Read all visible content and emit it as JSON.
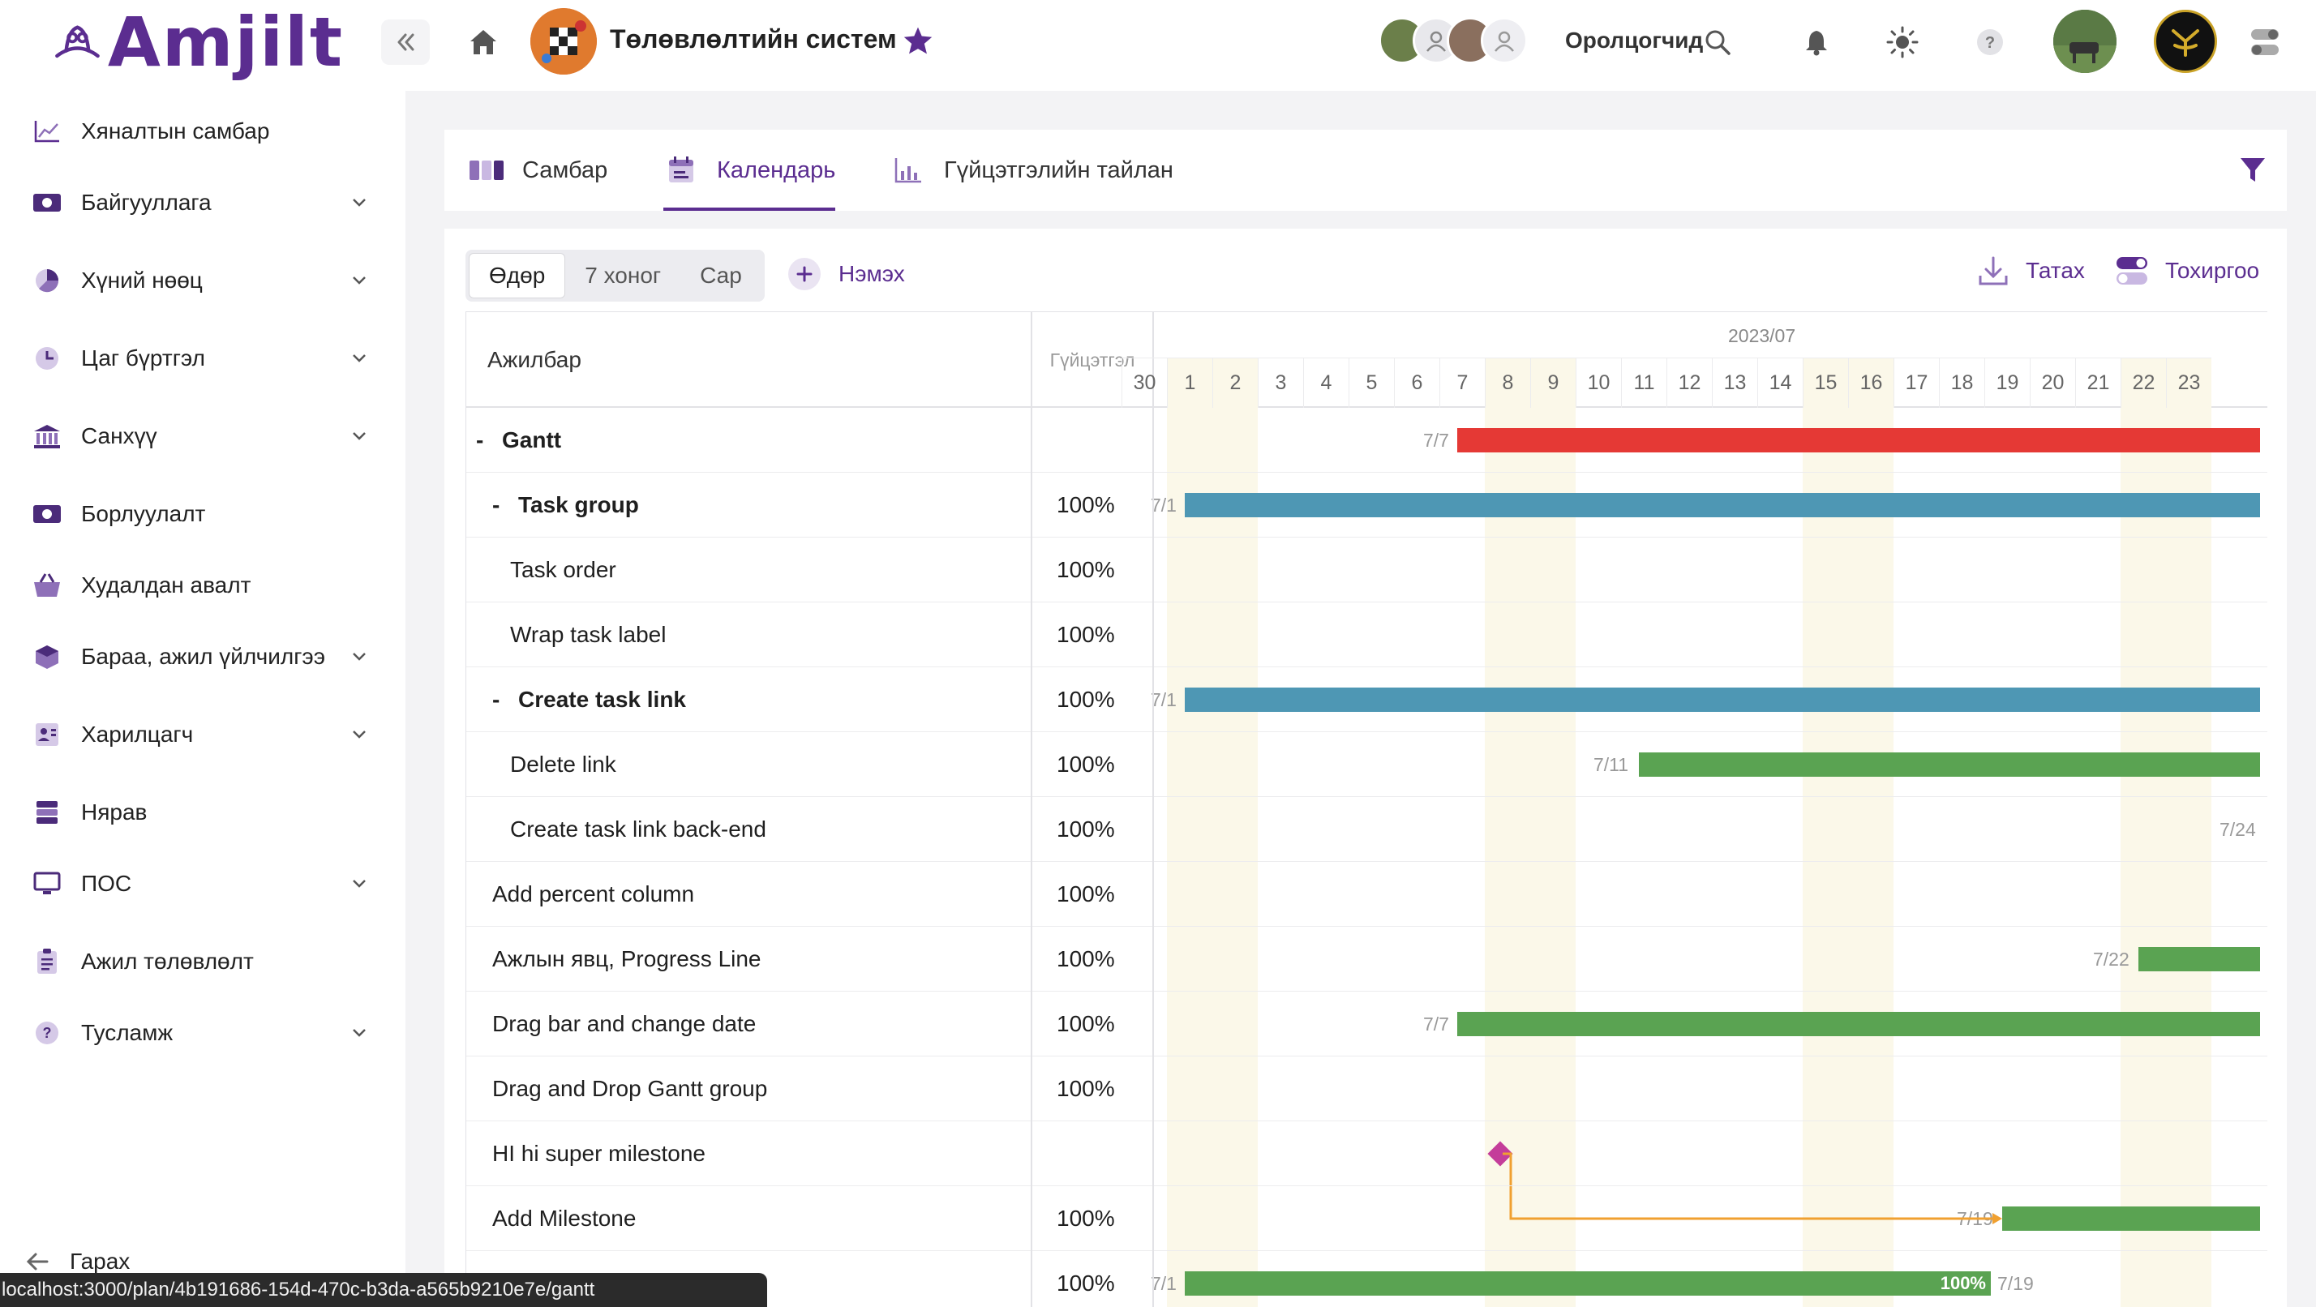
{
  "brand": {
    "name": "Amjilt",
    "color": "#5b2d90"
  },
  "header": {
    "project_title": "Төлөвлөлтийн систем",
    "participants_label": "Оролцогчид",
    "collapse_icon": "double-chevron-left-icon",
    "home_icon": "home-icon",
    "star_icon": "star-icon",
    "search_icon": "search-icon",
    "bell_icon": "bell-icon",
    "theme_icon": "sun-icon",
    "help_icon": "help-icon"
  },
  "sidebar": {
    "items": [
      {
        "label": "Хяналтын самбар",
        "icon": "chart-line-icon",
        "has_children": false
      },
      {
        "label": "Байгууллага",
        "icon": "money-icon",
        "has_children": true
      },
      {
        "label": "Хүний нөөц",
        "icon": "pie-icon",
        "has_children": true
      },
      {
        "label": "Цаг бүртгэл",
        "icon": "clock-icon",
        "has_children": true
      },
      {
        "label": "Санхүү",
        "icon": "bank-icon",
        "has_children": true
      },
      {
        "label": "Борлуулалт",
        "icon": "money-icon",
        "has_children": false
      },
      {
        "label": "Худалдан авалт",
        "icon": "basket-icon",
        "has_children": false
      },
      {
        "label": "Бараа, ажил үйлчилгээ",
        "icon": "box-icon",
        "has_children": true
      },
      {
        "label": "Харилцагч",
        "icon": "contact-icon",
        "has_children": true
      },
      {
        "label": "Нярав",
        "icon": "archive-icon",
        "has_children": false
      },
      {
        "label": "ПОС",
        "icon": "monitor-icon",
        "has_children": true
      },
      {
        "label": "Ажил төлөвлөлт",
        "icon": "clipboard-icon",
        "has_children": false
      },
      {
        "label": "Тусламж",
        "icon": "help-icon",
        "has_children": true
      }
    ],
    "logout_label": "Гарах"
  },
  "status_bar": {
    "url": "localhost:3000/plan/4b191686-154d-470c-b3da-a565b9210e7e/gantt"
  },
  "tabs": [
    {
      "label": "Самбар",
      "icon": "kanban-icon",
      "active": false
    },
    {
      "label": "Календарь",
      "icon": "calendar-icon",
      "active": true
    },
    {
      "label": "Гүйцэтгэлийн тайлан",
      "icon": "bar-report-icon",
      "active": false
    }
  ],
  "toolbar": {
    "views": [
      "Өдөр",
      "7 хоног",
      "Сар"
    ],
    "active_view": "Өдөр",
    "add_label": "Нэмэх",
    "download_label": "Татах",
    "settings_label": "Тохиргоо"
  },
  "gantt": {
    "col_task": "Ажилбар",
    "col_progress": "Гүйцэтгэл",
    "month": "2023/07",
    "days": [
      "30",
      "1",
      "2",
      "3",
      "4",
      "5",
      "6",
      "7",
      "8",
      "9",
      "10",
      "11",
      "12",
      "13",
      "14",
      "15",
      "16",
      "17",
      "18",
      "19",
      "20",
      "21",
      "22",
      "23"
    ],
    "weekend_days": [
      "1",
      "2",
      "8",
      "9",
      "15",
      "16",
      "22",
      "23"
    ],
    "colors": {
      "red": "#e53935",
      "blue": "#4e97b4",
      "green": "#5aa352",
      "milestone": "#c43d9a",
      "link": "#f0a030",
      "weekend": "#fbf8e9"
    },
    "rows": [
      {
        "name": "Gantt",
        "level": 0,
        "group": true,
        "toggle": "-",
        "progress": "",
        "start_label": "7/7",
        "bar_color": "red"
      },
      {
        "name": "Task group",
        "level": 1,
        "group": true,
        "toggle": "-",
        "progress": "100%",
        "start_label": "7/1",
        "bar_color": "blue"
      },
      {
        "name": "Task order",
        "level": 2,
        "group": false,
        "toggle": "",
        "progress": "100%",
        "start_label": "",
        "bar_color": ""
      },
      {
        "name": "Wrap task label",
        "level": 2,
        "group": false,
        "toggle": "",
        "progress": "100%",
        "start_label": "",
        "bar_color": ""
      },
      {
        "name": "Create task link",
        "level": 1,
        "group": true,
        "toggle": "-",
        "progress": "100%",
        "start_label": "7/1",
        "bar_color": "blue"
      },
      {
        "name": "Delete link",
        "level": 2,
        "group": false,
        "toggle": "",
        "progress": "100%",
        "start_label": "7/11",
        "bar_color": "green"
      },
      {
        "name": "Create task link back-end",
        "level": 2,
        "group": false,
        "toggle": "",
        "progress": "100%",
        "start_label": "7/24",
        "bar_color": ""
      },
      {
        "name": "Add percent column",
        "level": 1,
        "group": false,
        "toggle": "",
        "progress": "100%",
        "start_label": "",
        "bar_color": ""
      },
      {
        "name": "Ажлын явц, Progress Line",
        "level": 1,
        "group": false,
        "toggle": "",
        "progress": "100%",
        "start_label": "7/22",
        "bar_color": "green"
      },
      {
        "name": "Drag bar and change date",
        "level": 1,
        "group": false,
        "toggle": "",
        "progress": "100%",
        "start_label": "7/7",
        "bar_color": "green"
      },
      {
        "name": "Drag and Drop Gantt group",
        "level": 1,
        "group": false,
        "toggle": "",
        "progress": "100%",
        "start_label": "",
        "bar_color": ""
      },
      {
        "name": "HI hi super milestone",
        "level": 1,
        "group": false,
        "toggle": "",
        "progress": "",
        "start_label": "",
        "bar_color": "",
        "milestone": true
      },
      {
        "name": "Add Milestone",
        "level": 1,
        "group": false,
        "toggle": "",
        "progress": "100%",
        "start_label": "7/19",
        "bar_color": "green"
      },
      {
        "name": "",
        "level": 1,
        "group": false,
        "toggle": "",
        "progress": "100%",
        "start_label": "7/1",
        "end_label": "7/19",
        "bar_label": "100%",
        "bar_color": "green"
      }
    ]
  }
}
